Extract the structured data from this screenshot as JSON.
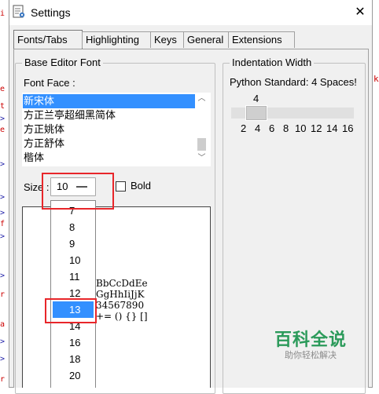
{
  "window": {
    "title": "Settings",
    "close_glyph": "✕"
  },
  "tabs": [
    {
      "label": "Fonts/Tabs",
      "active": true
    },
    {
      "label": "Highlighting"
    },
    {
      "label": "Keys"
    },
    {
      "label": "General"
    },
    {
      "label": "Extensions"
    }
  ],
  "font_group": {
    "title": "Base Editor Font",
    "font_face_label": "Font Face :",
    "fonts": [
      "新宋体",
      "方正兰亭超细黑简体",
      "方正姚体",
      "方正舒体",
      "楷体"
    ],
    "selected_font": "新宋体",
    "size_label": "Size :",
    "size_value": "10",
    "bold_label": "Bold",
    "bold_checked": false
  },
  "size_options": [
    "7",
    "8",
    "9",
    "10",
    "11",
    "12",
    "13",
    "14",
    "16",
    "18",
    "20"
  ],
  "selected_size_option": "13",
  "sample_lines": [
    "BbCcDdEe",
    "GgHhIiJjK",
    "34567890",
    "+= () {} []"
  ],
  "indent_group": {
    "title": "Indentation Width",
    "description": "Python Standard: 4 Spaces!",
    "value": "4",
    "ticks": [
      "2",
      "4",
      "6",
      "8",
      "10",
      "12",
      "14",
      "16"
    ]
  },
  "watermark": {
    "title": "百科全说",
    "subtitle": "助你轻松解决"
  },
  "colors": {
    "selection": "#3390ff",
    "highlight_box": "#e8262a",
    "watermark": "#2b9a5a"
  },
  "icons": {
    "app": "python-settings-icon",
    "close": "close-icon",
    "scroll_up": "chevron-up-icon",
    "scroll_down": "chevron-down-icon",
    "combo": "dropdown-dash-icon"
  }
}
